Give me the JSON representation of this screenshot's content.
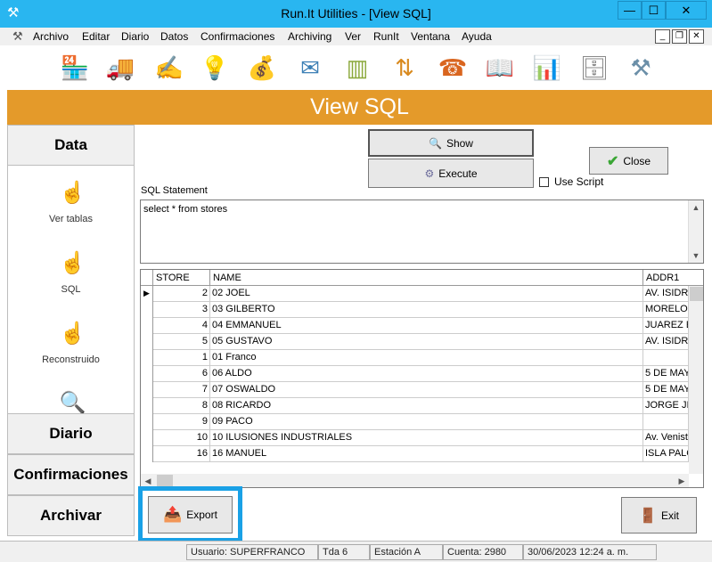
{
  "window": {
    "title": "Run.It Utilities - [View SQL]",
    "min_glyph": "—",
    "max_glyph": "☐",
    "close_glyph": "✕"
  },
  "menubar": {
    "items": [
      "Archivo",
      "Editar",
      "Diario",
      "Datos",
      "Confirmaciones",
      "Archiving",
      "Ver",
      "RunIt",
      "Ventana",
      "Ayuda"
    ]
  },
  "toolbar": {
    "icons": [
      "store-icon",
      "truck-icon",
      "signature-icon",
      "lightbulb-icon",
      "coins-icon",
      "mail-icon",
      "barcode-icon",
      "transfer-icon",
      "phone-book-icon",
      "open-book-icon",
      "presentation-icon",
      "archive-icon",
      "tools-icon"
    ]
  },
  "header": {
    "title": "View SQL"
  },
  "left_nav": {
    "data_label": "Data",
    "items": [
      {
        "label": "Ver tablas",
        "icon": "hand-pointer-icon"
      },
      {
        "label": "SQL",
        "icon": "hand-pointer-icon"
      },
      {
        "label": "Reconstruido",
        "icon": "hand-pointer-icon"
      }
    ],
    "diario_label": "Diario",
    "confirmaciones_label": "Confirmaciones",
    "archivar_label": "Archivar"
  },
  "actions": {
    "show_label": "Show",
    "execute_label": "Execute",
    "close_label": "Close",
    "use_script_label": "Use Script",
    "export_label": "Export",
    "exit_label": "Exit"
  },
  "sql": {
    "label": "SQL Statement",
    "value": "select * from stores"
  },
  "grid": {
    "columns": [
      "STORE",
      "NAME",
      "ADDR1"
    ],
    "rows": [
      {
        "store": "2",
        "name": "02 JOEL",
        "addr1": "AV. ISIDR"
      },
      {
        "store": "3",
        "name": "03 GILBERTO",
        "addr1": "MORELOS"
      },
      {
        "store": "4",
        "name": "04 EMMANUEL",
        "addr1": "JUAREZ E"
      },
      {
        "store": "5",
        "name": "05 GUSTAVO",
        "addr1": "AV. ISIDR"
      },
      {
        "store": "1",
        "name": "01 Franco",
        "addr1": ""
      },
      {
        "store": "6",
        "name": "06 ALDO",
        "addr1": "5 DE MAY"
      },
      {
        "store": "7",
        "name": "07 OSWALDO",
        "addr1": "5 DE MAY"
      },
      {
        "store": "8",
        "name": "08 RICARDO",
        "addr1": "JORGE JII"
      },
      {
        "store": "9",
        "name": "09 PACO",
        "addr1": ""
      },
      {
        "store": "10",
        "name": "10 ILUSIONES INDUSTRIALES",
        "addr1": "Av. Venist"
      },
      {
        "store": "16",
        "name": "16 MANUEL",
        "addr1": "ISLA PALC"
      }
    ]
  },
  "status": {
    "usuario": "Usuario: SUPERFRANCO",
    "tienda": "Tda 6",
    "estacion": "Estación A",
    "cuenta": "Cuenta: 2980",
    "fecha": "30/06/2023 12:24 a. m."
  },
  "colors": {
    "titlebar": "#29b6f0",
    "header": "#e49a2a",
    "highlight": "#1aa1e6"
  }
}
